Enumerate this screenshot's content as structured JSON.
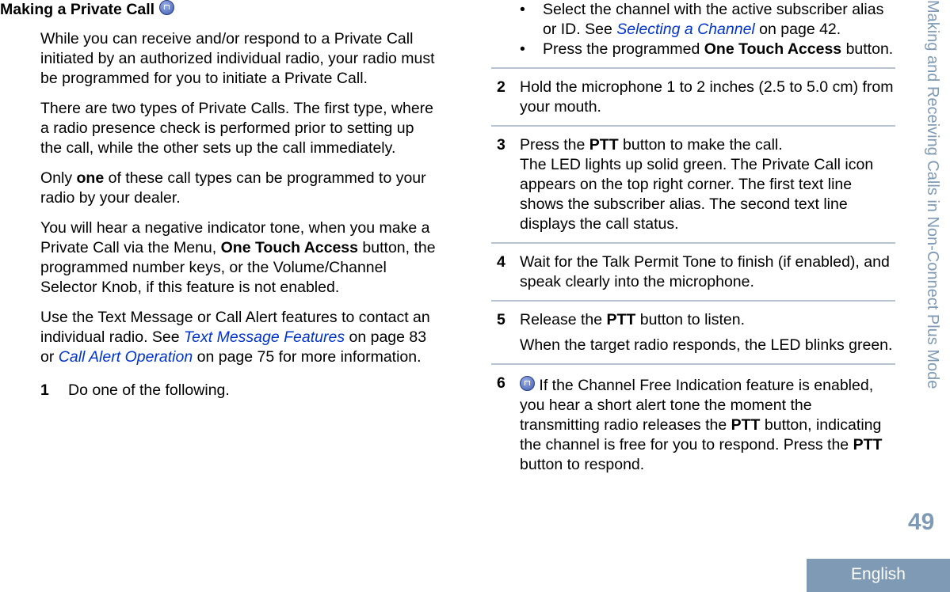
{
  "heading": "Making a Private Call",
  "left": {
    "p1": "While you can receive and/or respond to a Private Call initiated by an authorized individual radio, your radio must be programmed for you to initiate a Private Call.",
    "p2": "There are two types of Private Calls. The first type, where a radio presence check is performed prior to setting up the call, while the other sets up the call immediately.",
    "p3": {
      "a": "Only ",
      "b": "one",
      "c": " of these call types can be programmed to your radio by your dealer."
    },
    "p4": {
      "a": "You will hear a negative indicator tone, when you make a Private Call via the Menu, ",
      "b": "One Touch Access",
      "c": " button, the programmed number keys, or the Volume/Channel Selector Knob, if this feature is not enabled."
    },
    "p5": {
      "a": "Use the Text Message or Call Alert features to contact an individual radio. See ",
      "link1": "Text Message Features",
      "b": " on page 83 or ",
      "link2": "Call Alert Operation",
      "c": " on page 75 for more information."
    },
    "step1": {
      "num": "1",
      "text": "Do one of the following."
    }
  },
  "right": {
    "bullet1": {
      "a": "Select the channel with the active subscriber alias or ID. See ",
      "link": "Selecting a Channel",
      "b": " on page 42."
    },
    "bullet2": {
      "a": "Press the programmed ",
      "b": "One Touch Access",
      "c": " button."
    },
    "bullet_char": "•",
    "steps": [
      {
        "num": "2",
        "text": "Hold the microphone 1 to 2 inches (2.5 to 5.0 cm) from your mouth."
      },
      {
        "num": "3",
        "a": "Press the ",
        "b": "PTT",
        "c": " button to make the call.",
        "d": "The LED lights up solid green. The Private Call icon appears on the top right corner. The first text line shows the subscriber alias. The second text line displays the call status."
      },
      {
        "num": "4",
        "text": "Wait for the Talk Permit Tone to finish (if enabled), and speak clearly into the microphone."
      },
      {
        "num": "5",
        "a": "Release the ",
        "b": "PTT",
        "c": " button to listen.",
        "d": "When the target radio responds, the LED blinks green."
      },
      {
        "num": "6",
        "a": " If the Channel Free Indication feature is enabled, you hear a short alert tone the moment the transmitting radio releases the ",
        "b": "PTT",
        "c": " button, indicating the channel is free for you to respond. Press the ",
        "d": "PTT",
        "e": " button to respond."
      }
    ]
  },
  "sidebar": {
    "chapter": "Making and Receiving Calls in Non-Connect Plus Mode",
    "page": "49",
    "language": "English"
  },
  "colors": {
    "accent": "#7f9ab5",
    "link": "#0033cc"
  }
}
